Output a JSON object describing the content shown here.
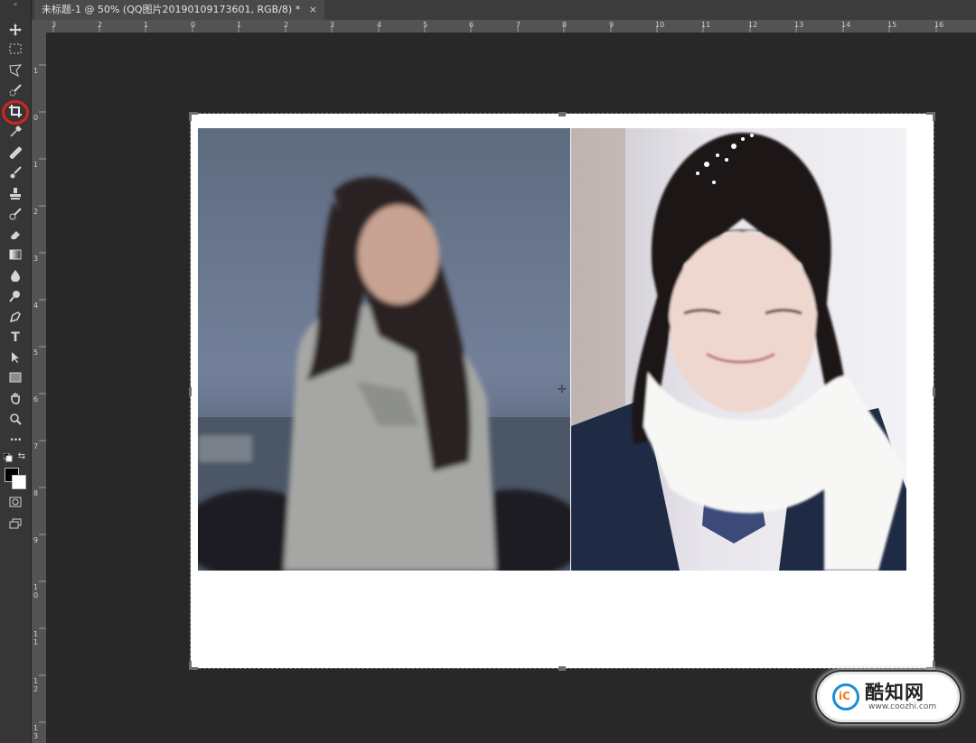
{
  "document_tab": {
    "title": "未标题-1 @ 50% (QQ图片20190109173601, RGB/8) *",
    "close_glyph": "×"
  },
  "toolbar": {
    "grip": "»",
    "tools": [
      {
        "name": "move-tool",
        "icon": "move-icon"
      },
      {
        "name": "marquee-tool",
        "icon": "rect-marquee-icon"
      },
      {
        "name": "lasso-tool",
        "icon": "polygon-lasso-icon"
      },
      {
        "name": "quick-selection-tool",
        "icon": "quick-select-icon"
      },
      {
        "name": "crop-tool",
        "icon": "crop-icon",
        "highlighted": true,
        "highlight_color": "#d9231b"
      },
      {
        "name": "eyedropper-tool",
        "icon": "eyedropper-icon"
      },
      {
        "name": "healing-brush-tool",
        "icon": "bandage-icon"
      },
      {
        "name": "brush-tool",
        "icon": "brush-icon"
      },
      {
        "name": "clone-stamp-tool",
        "icon": "stamp-icon"
      },
      {
        "name": "history-brush-tool",
        "icon": "history-brush-icon"
      },
      {
        "name": "eraser-tool",
        "icon": "eraser-icon"
      },
      {
        "name": "gradient-tool",
        "icon": "gradient-icon"
      },
      {
        "name": "blur-tool",
        "icon": "drop-icon"
      },
      {
        "name": "dodge-tool",
        "icon": "dodge-icon"
      },
      {
        "name": "pen-tool",
        "icon": "pen-icon"
      },
      {
        "name": "type-tool",
        "icon": "type-icon",
        "glyph": "T"
      },
      {
        "name": "path-selection-tool",
        "icon": "arrow-icon"
      },
      {
        "name": "rectangle-tool",
        "icon": "rectangle-icon"
      },
      {
        "name": "hand-tool",
        "icon": "hand-icon"
      },
      {
        "name": "zoom-tool",
        "icon": "zoom-icon"
      },
      {
        "name": "more-tools",
        "icon": "ellipsis-icon",
        "glyph": "•••"
      }
    ],
    "foreground_color": "#000000",
    "background_color": "#ffffff"
  },
  "ruler_top_labels": [
    "3",
    "2",
    "1",
    "0",
    "1",
    "2",
    "3",
    "4",
    "5",
    "6",
    "7",
    "8",
    "9",
    "10",
    "11",
    "12",
    "13",
    "14",
    "15",
    "16"
  ],
  "ruler_left_labels": [
    "1",
    "0",
    "1",
    "2",
    "3",
    "4",
    "5",
    "6",
    "7",
    "8",
    "9",
    "1 0",
    "1 1",
    "1 2",
    "1 3"
  ],
  "canvas": {
    "background": "#ffffff",
    "left_photo": "blurred-woman-grey-sweater-by-sea",
    "right_photo": "girl-braids-white-scarf-snow"
  },
  "watermark": {
    "logo_text": "iC",
    "name": "酷知网",
    "url": "www.coozhi.com"
  }
}
